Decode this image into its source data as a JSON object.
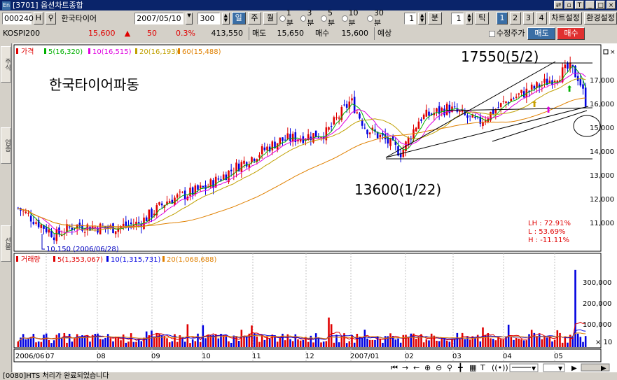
{
  "window": {
    "title": "[3701] 옵션차트종합",
    "icon_label": "En"
  },
  "toolbar": {
    "code": "000240",
    "h_label": "H",
    "search_icon": "magnifier-icon",
    "name": "한국타이어",
    "date": "2007/05/10",
    "count": "300",
    "period_tabs": [
      "일",
      "주",
      "월"
    ],
    "minute_options": [
      "1분",
      "3분",
      "5분",
      "10분",
      "30분"
    ],
    "min_value": "1",
    "min_unit": "분",
    "tick_value": "1",
    "tick_unit": "틱",
    "layout_buttons": [
      "1",
      "2",
      "3",
      "4"
    ],
    "chart_settings": "차트설정",
    "env_settings": "환경설정"
  },
  "pricebar": {
    "index_name": "KOSPI200",
    "price": "15,600",
    "change_arrow": "▲",
    "change": "50",
    "change_pct": "0.3%",
    "volume": "413,550",
    "ask_label": "매도",
    "ask": "15,650",
    "bid_label": "매수",
    "bid": "15,600",
    "expected_label": "예상",
    "adjusted_label": "수정주가",
    "sell_button": "매도",
    "buy_button": "매수"
  },
  "sidebar": {
    "tabs": [
      "주식",
      "업종",
      "선물"
    ]
  },
  "colors": {
    "up": "#e00000",
    "down": "#0000e0",
    "ma5": "#00b000",
    "ma10": "#e000e0",
    "ma20": "#c0a000",
    "ma60": "#e08000"
  },
  "chart_data": {
    "type": "candlestick",
    "price_legend": {
      "label": "가격",
      "ma": [
        {
          "name": "5(16,320)",
          "color": "#00b000"
        },
        {
          "name": "10(16,515)",
          "color": "#e000e0"
        },
        {
          "name": "20(16,193)",
          "color": "#c0a000"
        },
        {
          "name": "60(15,488)",
          "color": "#e08000"
        }
      ]
    },
    "annotations": {
      "stock_label": "한국타이어파동",
      "high_label": "17550(5/2)",
      "low_label": "13600(1/22)",
      "min_label": "10,150 (2006/06/28)"
    },
    "stats": [
      "LH :  72.91%",
      "L  :  53.69%",
      "H  : -11.11%"
    ],
    "price_axis": {
      "ticks": [
        "17,000",
        "16,000",
        "15,000",
        "14,000",
        "13,000",
        "12,000",
        "11,000"
      ],
      "range": [
        10000,
        18000
      ]
    },
    "volume_legend": {
      "label": "거래량",
      "ma": [
        {
          "name": "5(1,353,067)",
          "color": "#e00000"
        },
        {
          "name": "10(1,315,731)",
          "color": "#0000e0"
        },
        {
          "name": "20(1,068,688)",
          "color": "#e08000"
        }
      ]
    },
    "volume_axis": {
      "ticks": [
        "300,000",
        "200,000",
        "100,000"
      ],
      "unit": "× 10"
    },
    "x_labels": [
      "2006/06",
      "07",
      "08",
      "09",
      "10",
      "11",
      "12",
      "2007/01",
      "02",
      "03",
      "04",
      "05"
    ]
  },
  "status": "[0080]HTS 처리가 완료되었습니다"
}
